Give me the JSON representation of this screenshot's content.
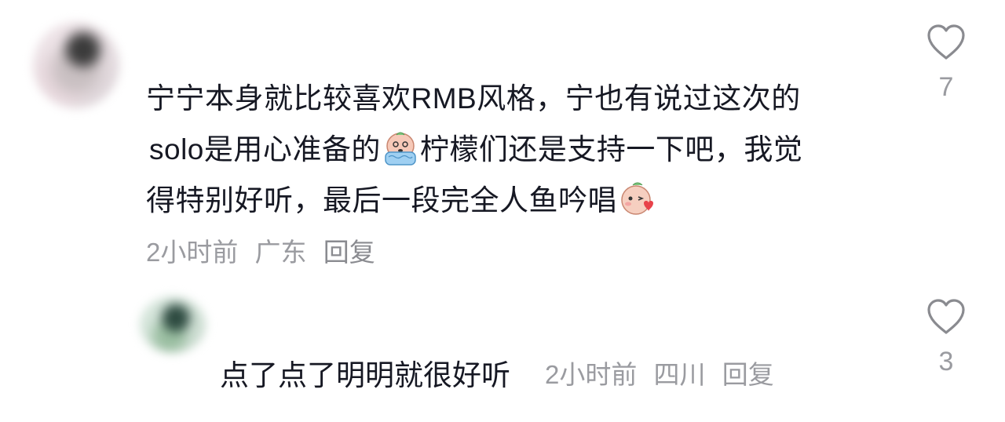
{
  "comments": [
    {
      "text_line1": "宁宁本身就比较喜欢RMB风格，宁也有说过这次的",
      "text_line2a": "solo是用心准备的",
      "emoji_a": "crying-emoji",
      "text_line2b": "柠檬们还是支持一下吧，我觉",
      "text_line3": "得特别好听，最后一段完全人鱼吟唱",
      "emoji_b": "kiss-heart-emoji",
      "time": "2小时前",
      "location": "广东",
      "reply_label": "回复",
      "likes": "7"
    },
    {
      "text": "点了点了明明就很好听",
      "time": "2小时前",
      "location": "四川",
      "reply_label": "回复",
      "likes": "3"
    }
  ],
  "icons": {
    "like": "heart-outline-icon"
  },
  "colors": {
    "text": "#161823",
    "meta": "#9a9ba0"
  }
}
